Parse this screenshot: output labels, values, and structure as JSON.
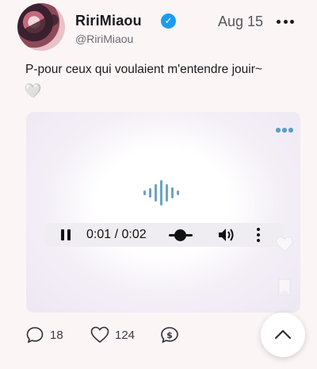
{
  "post": {
    "display_name": "RiriMiaou",
    "handle": "@RiriMiaou",
    "date": "Aug 15",
    "text": "P-pour ceux qui voulaient m'entendre jouir~",
    "emoji": "🤍"
  },
  "player": {
    "time": "0:01 / 0:02",
    "progress": 0.5
  },
  "actions": {
    "replies": "18",
    "likes": "124"
  },
  "icons": [
    "verified-icon",
    "more-icon",
    "waveform-icon",
    "pause-icon",
    "volume-icon",
    "reply-icon",
    "like-icon",
    "tip-icon",
    "chevron-up-icon"
  ],
  "colors": {
    "accent": "#1d9bf0",
    "waveform": "#6ba4c3",
    "background": "#fbf5f6"
  }
}
